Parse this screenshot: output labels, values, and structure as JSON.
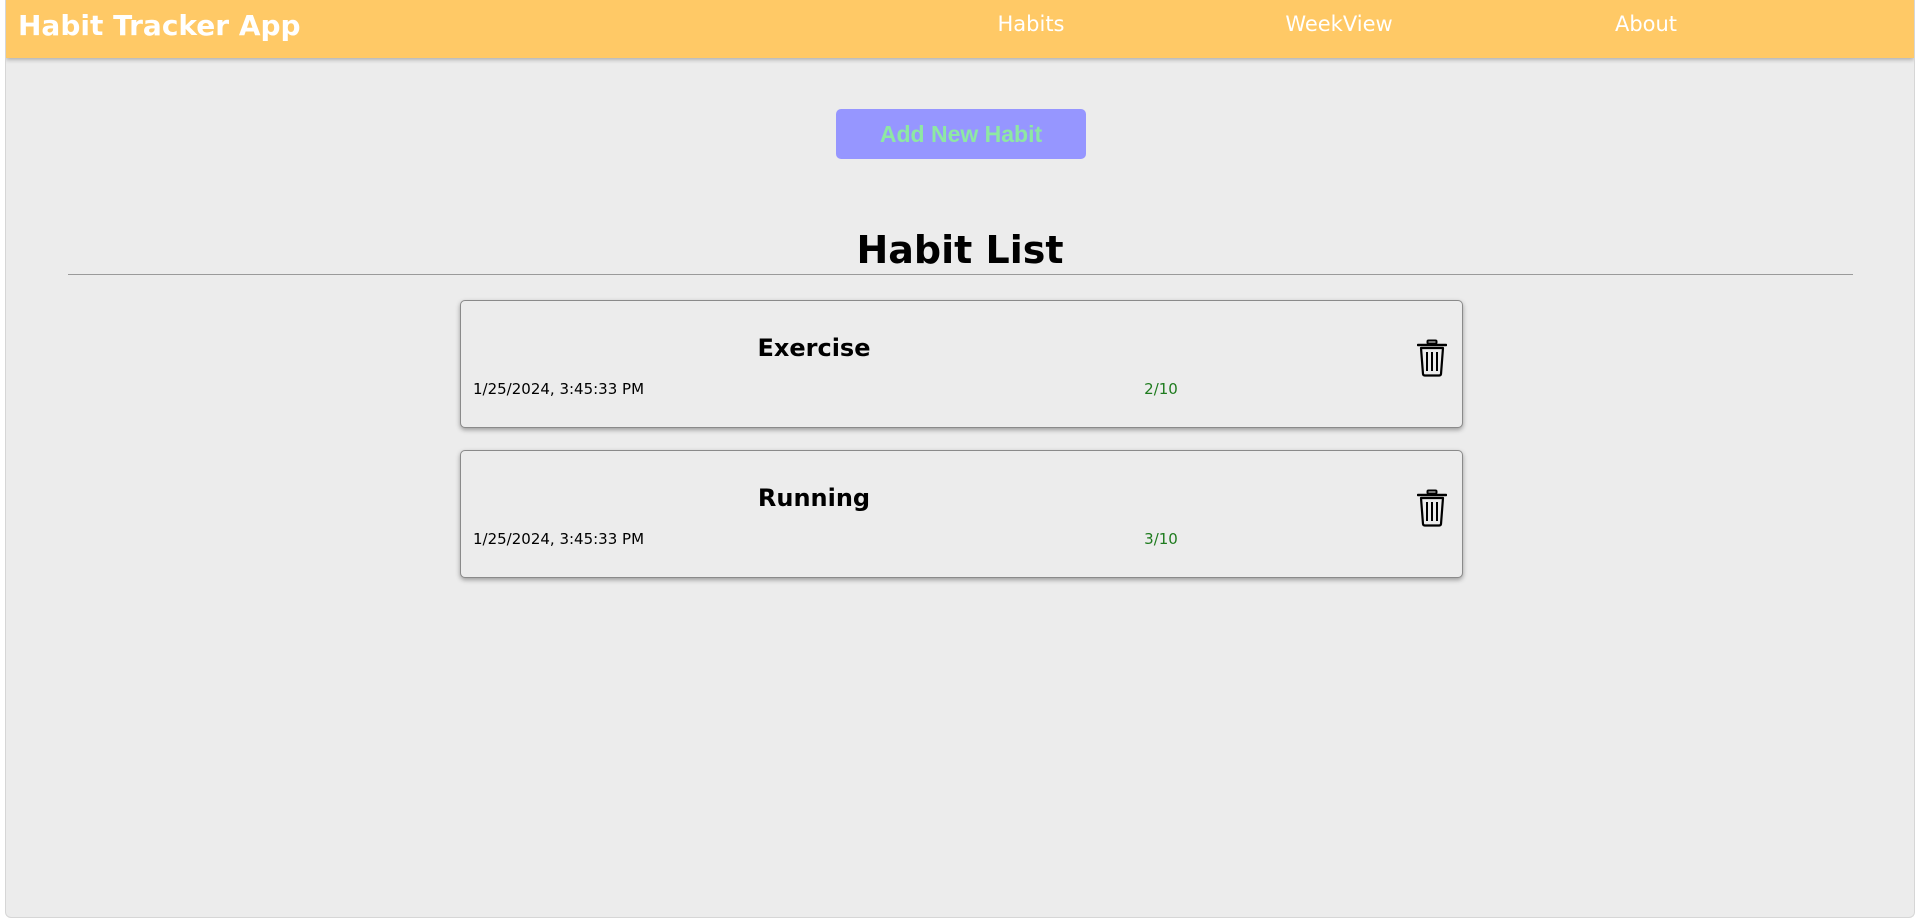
{
  "navbar": {
    "brand": "Habit Tracker App",
    "links": [
      "Habits",
      "WeekView",
      "About"
    ],
    "background": "#ffc966"
  },
  "main": {
    "add_button_label": "Add New Habit",
    "list_title": "Habit List",
    "habits": [
      {
        "name": "Exercise",
        "date": "1/25/2024, 3:45:33 PM",
        "progress": "2/10",
        "action_icon": "trash-icon"
      },
      {
        "name": "Running",
        "date": "1/25/2024, 3:45:33 PM",
        "progress": "3/10",
        "action_icon": "trash-icon"
      }
    ]
  },
  "colors": {
    "accent": "#9696ff",
    "button_text": "#8ee8a3",
    "progress_text": "#1e7b1e"
  }
}
